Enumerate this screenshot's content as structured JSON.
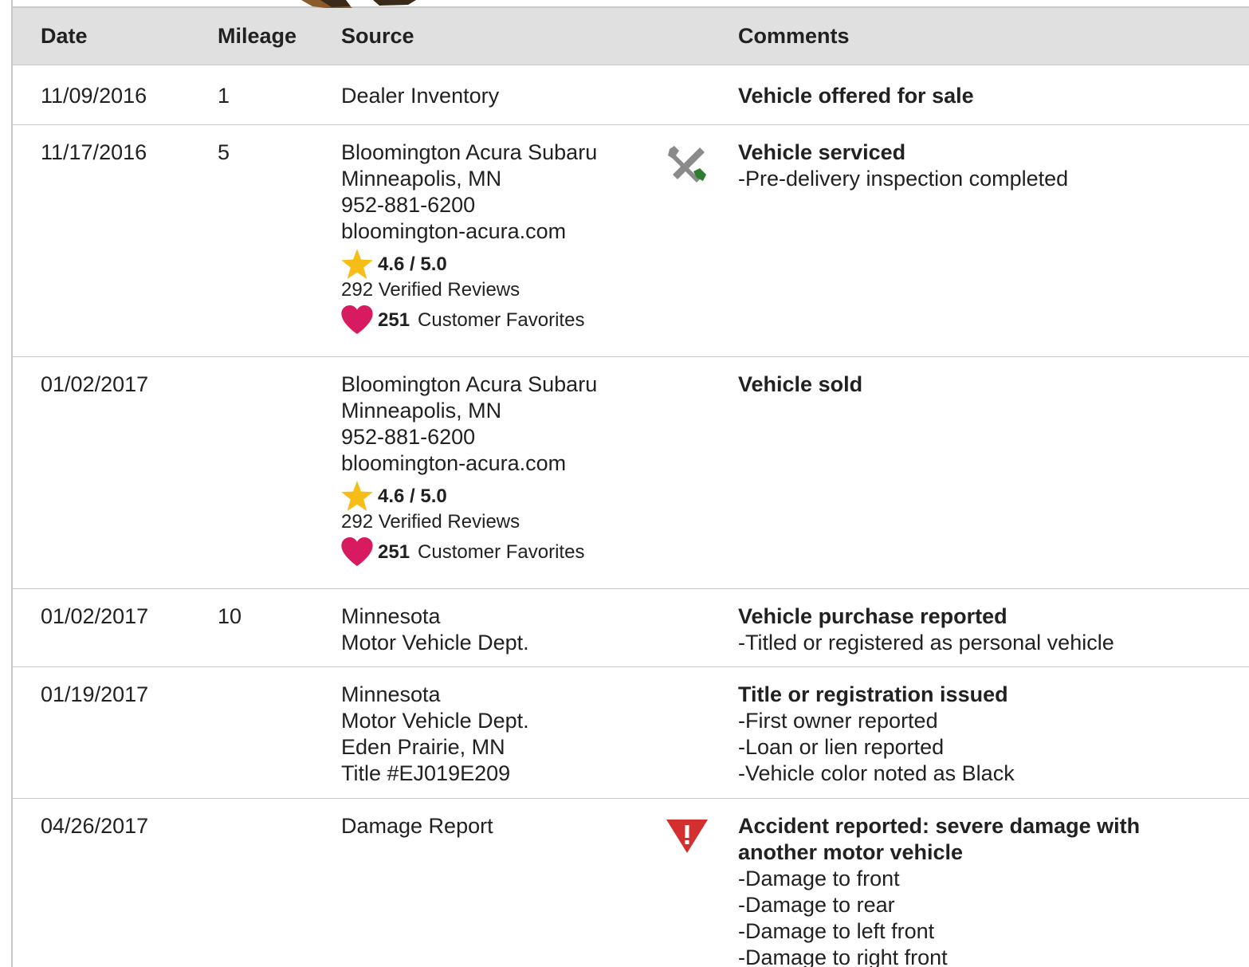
{
  "table": {
    "headers": {
      "date": "Date",
      "mileage": "Mileage",
      "source": "Source",
      "comments": "Comments"
    },
    "rows": [
      {
        "date": "11/09/2016",
        "mileage": "1",
        "source": [
          "Dealer Inventory"
        ],
        "icon": "",
        "title": "Vehicle offered for sale",
        "details": []
      },
      {
        "date": "11/17/2016",
        "mileage": "5",
        "source": [
          "Bloomington Acura Subaru",
          "Minneapolis, MN",
          "952-881-6200",
          "bloomington-acura.com"
        ],
        "rating": "4.6 / 5.0",
        "reviews": "292 Verified Reviews",
        "favorites_count": "251",
        "favorites_label": "Customer Favorites",
        "icon": "wrench-screwdriver-icon",
        "title": "Vehicle serviced",
        "details": [
          "Pre-delivery inspection completed"
        ]
      },
      {
        "date": "01/02/2017",
        "mileage": "",
        "source": [
          "Bloomington Acura Subaru",
          "Minneapolis, MN",
          "952-881-6200",
          "bloomington-acura.com"
        ],
        "rating": "4.6 / 5.0",
        "reviews": "292 Verified Reviews",
        "favorites_count": "251",
        "favorites_label": "Customer Favorites",
        "icon": "",
        "title": "Vehicle sold",
        "details": []
      },
      {
        "date": "01/02/2017",
        "mileage": "10",
        "source": [
          "Minnesota",
          "Motor Vehicle Dept."
        ],
        "icon": "",
        "title": "Vehicle purchase reported",
        "details": [
          "Titled or registered as personal vehicle"
        ]
      },
      {
        "date": "01/19/2017",
        "mileage": "",
        "source": [
          "Minnesota",
          "Motor Vehicle Dept.",
          "Eden Prairie, MN",
          "Title #EJ019E209"
        ],
        "icon": "",
        "title": "Title or registration issued",
        "details": [
          "First owner reported",
          "Loan or lien reported",
          "Vehicle color noted as Black"
        ]
      },
      {
        "date": "04/26/2017",
        "mileage": "",
        "source": [
          "Damage Report"
        ],
        "icon": "warning-triangle-icon",
        "title": "Accident reported: severe damage with another motor vehicle",
        "title_lines": [
          "Accident reported: severe damage with",
          "another motor vehicle"
        ],
        "details": [
          "Damage to front",
          "Damage to rear",
          "Damage to left front",
          "Damage to right front"
        ]
      }
    ]
  },
  "colors": {
    "header_bg": "#e0e0e0",
    "star": "#f6bd16",
    "heart": "#d81b60",
    "warning": "#d32f2f",
    "wrench": "#8a8a8a",
    "screwdriver_handle": "#2e7d32"
  }
}
